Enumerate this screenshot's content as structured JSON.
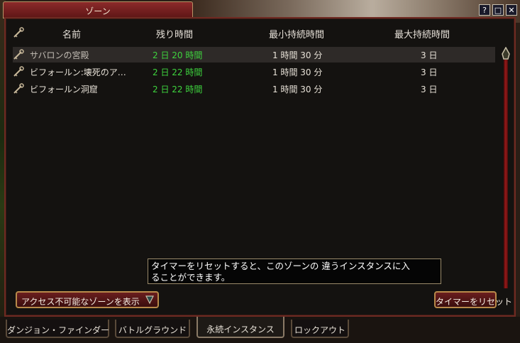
{
  "window": {
    "title": "ゾーン",
    "controls": {
      "help": "?",
      "minimize": "□",
      "close": "✕"
    }
  },
  "columns": {
    "name": "名前",
    "remaining": "残り時間",
    "min_duration": "最小持続時間",
    "max_duration": "最大持続時間"
  },
  "rows": [
    {
      "name": "サバロンの宮殿",
      "remaining": "2 日 20 時間",
      "min": "1 時間 30 分",
      "max": "3 日",
      "selected": true
    },
    {
      "name": "ビフォールン:壊死のア…",
      "remaining": "2 日 22 時間",
      "min": "1 時間 30 分",
      "max": "3 日",
      "selected": false
    },
    {
      "name": "ビフォールン洞窟",
      "remaining": "2 日 22 時間",
      "min": "1 時間 30 分",
      "max": "3 日",
      "selected": false
    }
  ],
  "tooltip": {
    "line1": "タイマーをリセットすると、このゾーンの 違うインスタンスに入",
    "line2": "ることができます。"
  },
  "buttons": {
    "show_inaccessible": "アクセス不可能なゾーンを表示",
    "reset_timer": "タイマーをリセット"
  },
  "tabs": [
    {
      "label": "ダンジョン・ファインダー",
      "active": false
    },
    {
      "label": "バトルグラウンド",
      "active": false
    },
    {
      "label": "永続インスタンス",
      "active": true
    },
    {
      "label": "ロックアウト",
      "active": false
    }
  ],
  "colors": {
    "remaining_time": "#3ed43e",
    "frame": "#6e2a22",
    "accent": "#b88a4a"
  },
  "icons": {
    "row_icon": "key-icon",
    "header_icon": "key-icon",
    "dropdown": "chevron-down-icon"
  }
}
